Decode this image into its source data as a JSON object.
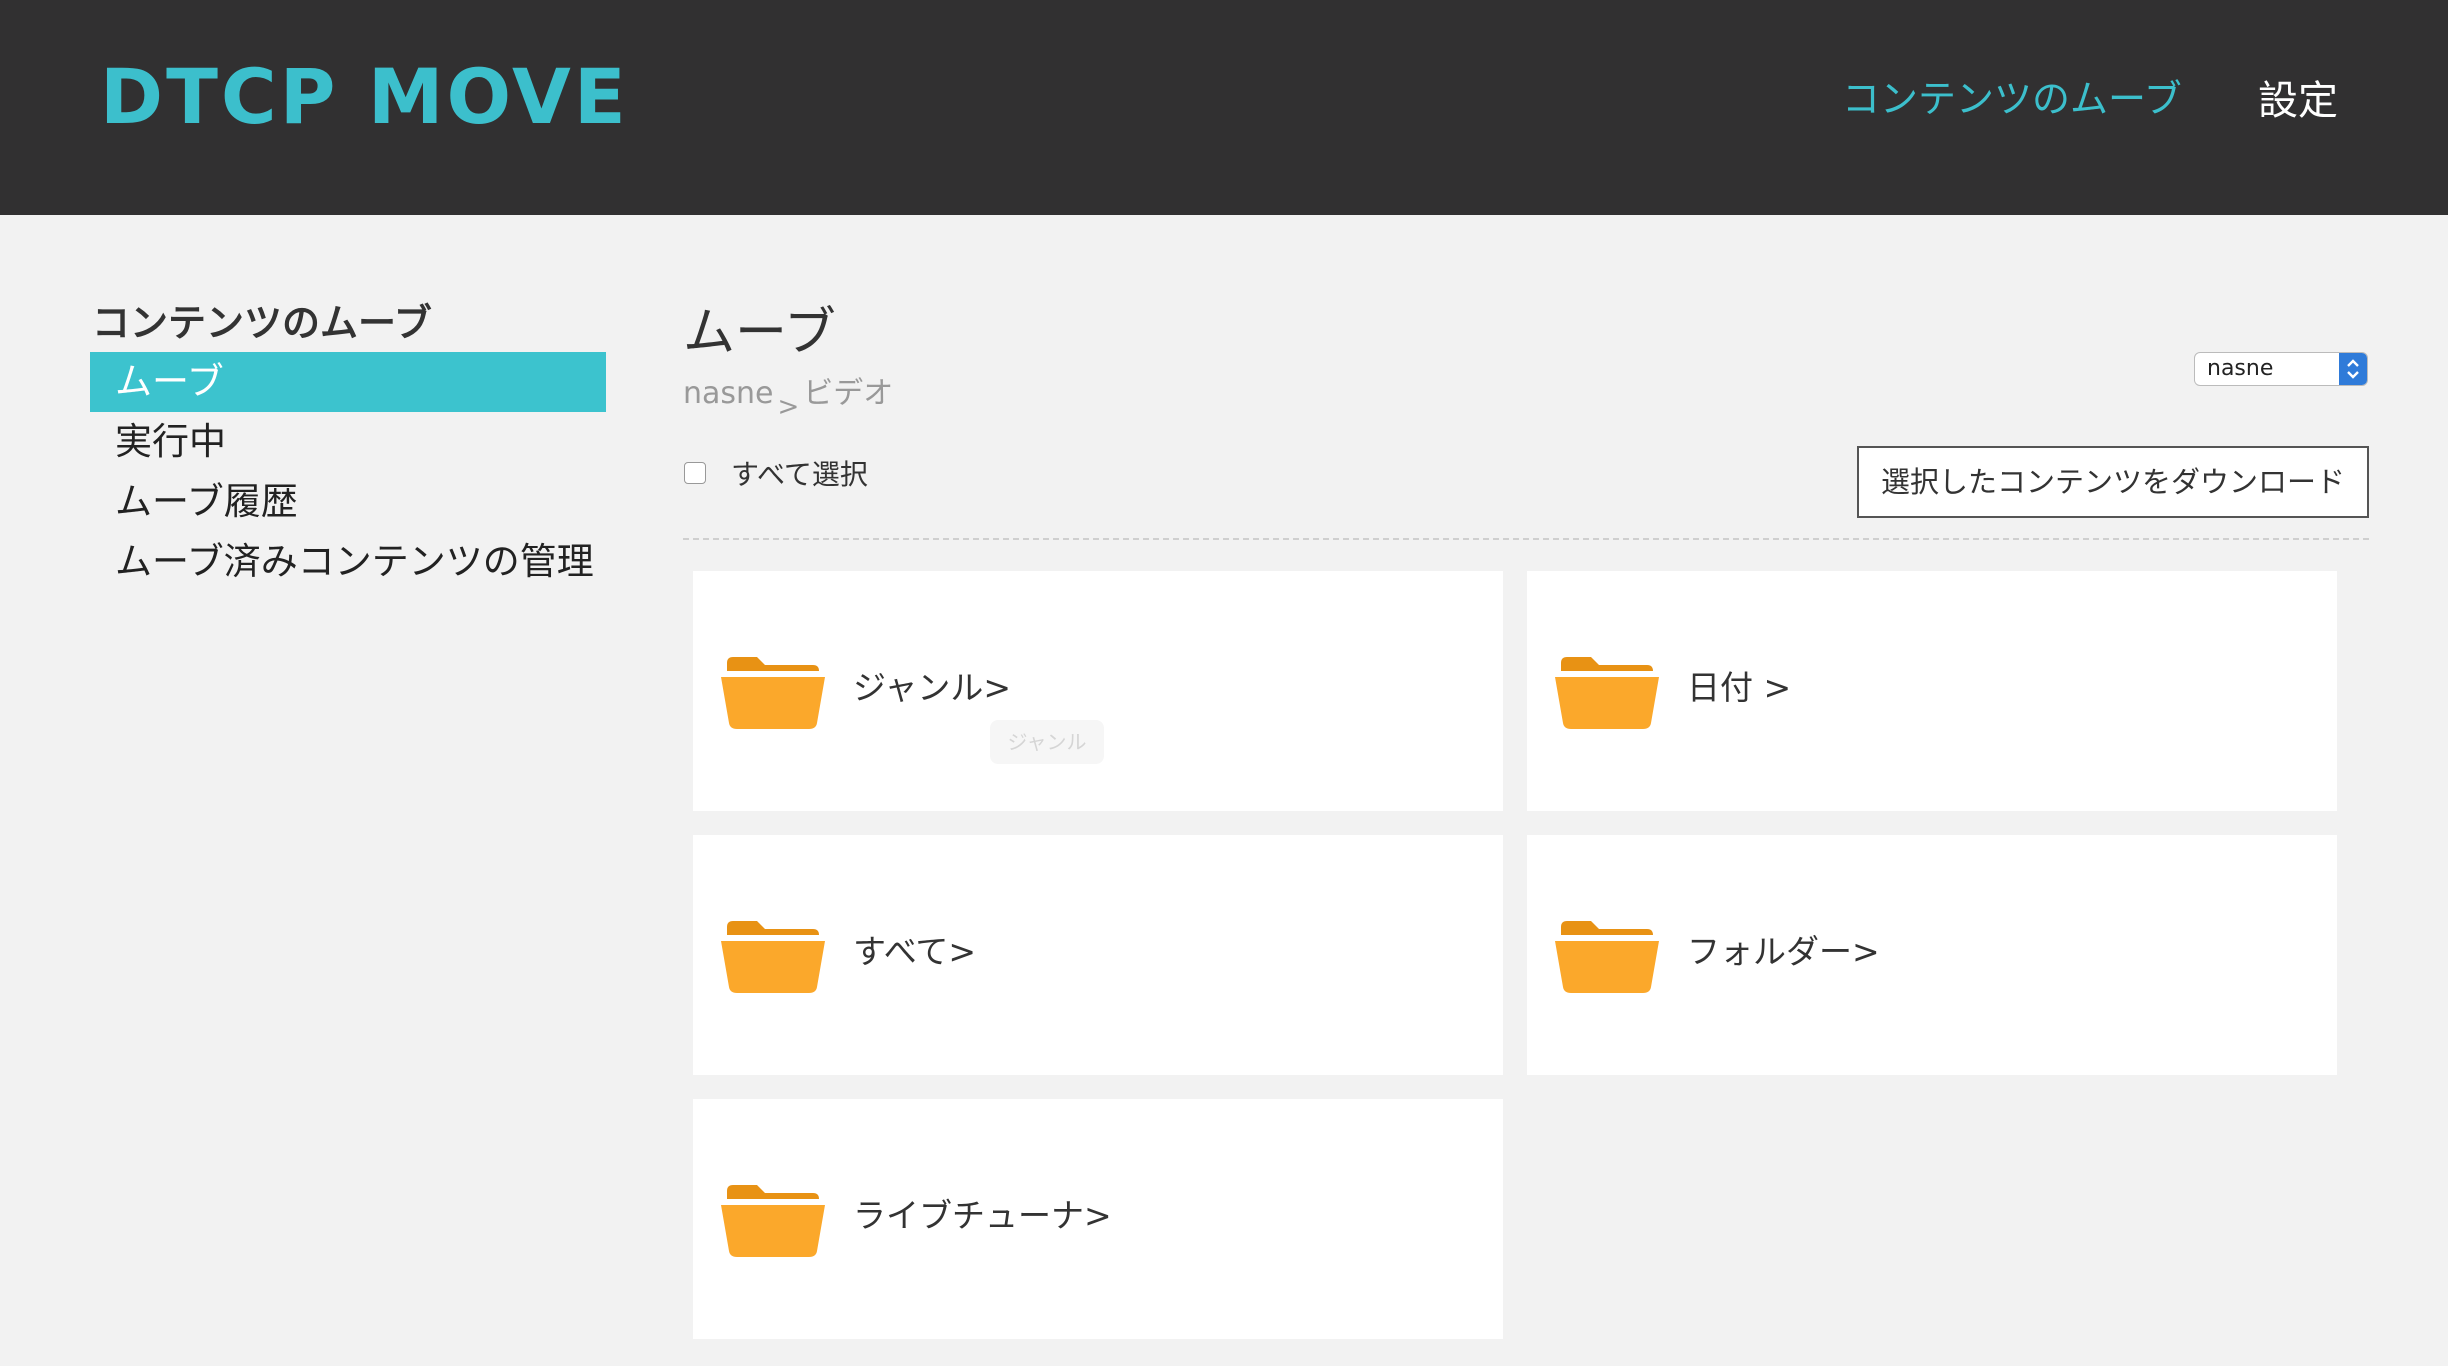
{
  "header": {
    "logo": "DTCP MOVE",
    "nav": [
      {
        "label": "コンテンツのムーブ",
        "active": true
      },
      {
        "label": "設定",
        "active": false
      }
    ]
  },
  "sidebar": {
    "heading": "コンテンツのムーブ",
    "items": [
      {
        "label": "ムーブ",
        "selected": true
      },
      {
        "label": "実行中",
        "selected": false
      },
      {
        "label": "ムーブ履歴",
        "selected": false
      },
      {
        "label": "ムーブ済みコンテンツの管理",
        "selected": false
      }
    ]
  },
  "main": {
    "title": "ムーブ",
    "breadcrumb": {
      "root": "nasne",
      "separator": ">",
      "current": "ビデオ"
    },
    "device_select": {
      "value": "nasne"
    },
    "select_all_label": "すべて選択",
    "download_button": "選択したコンテンツをダウンロード",
    "folders": [
      {
        "label": "ジャンル>",
        "icon": "folder-icon"
      },
      {
        "label": "日付 >",
        "icon": "folder-icon"
      },
      {
        "label": "すべて>",
        "icon": "folder-icon"
      },
      {
        "label": "フォルダー>",
        "icon": "folder-icon"
      },
      {
        "label": "ライブチューナ>",
        "icon": "folder-icon"
      }
    ],
    "tooltip": "ジャンル"
  },
  "colors": {
    "accent": "#3cc3ce",
    "header_bg": "#313031",
    "folder": "#fba82b",
    "page_bg": "#f2f2f2"
  }
}
